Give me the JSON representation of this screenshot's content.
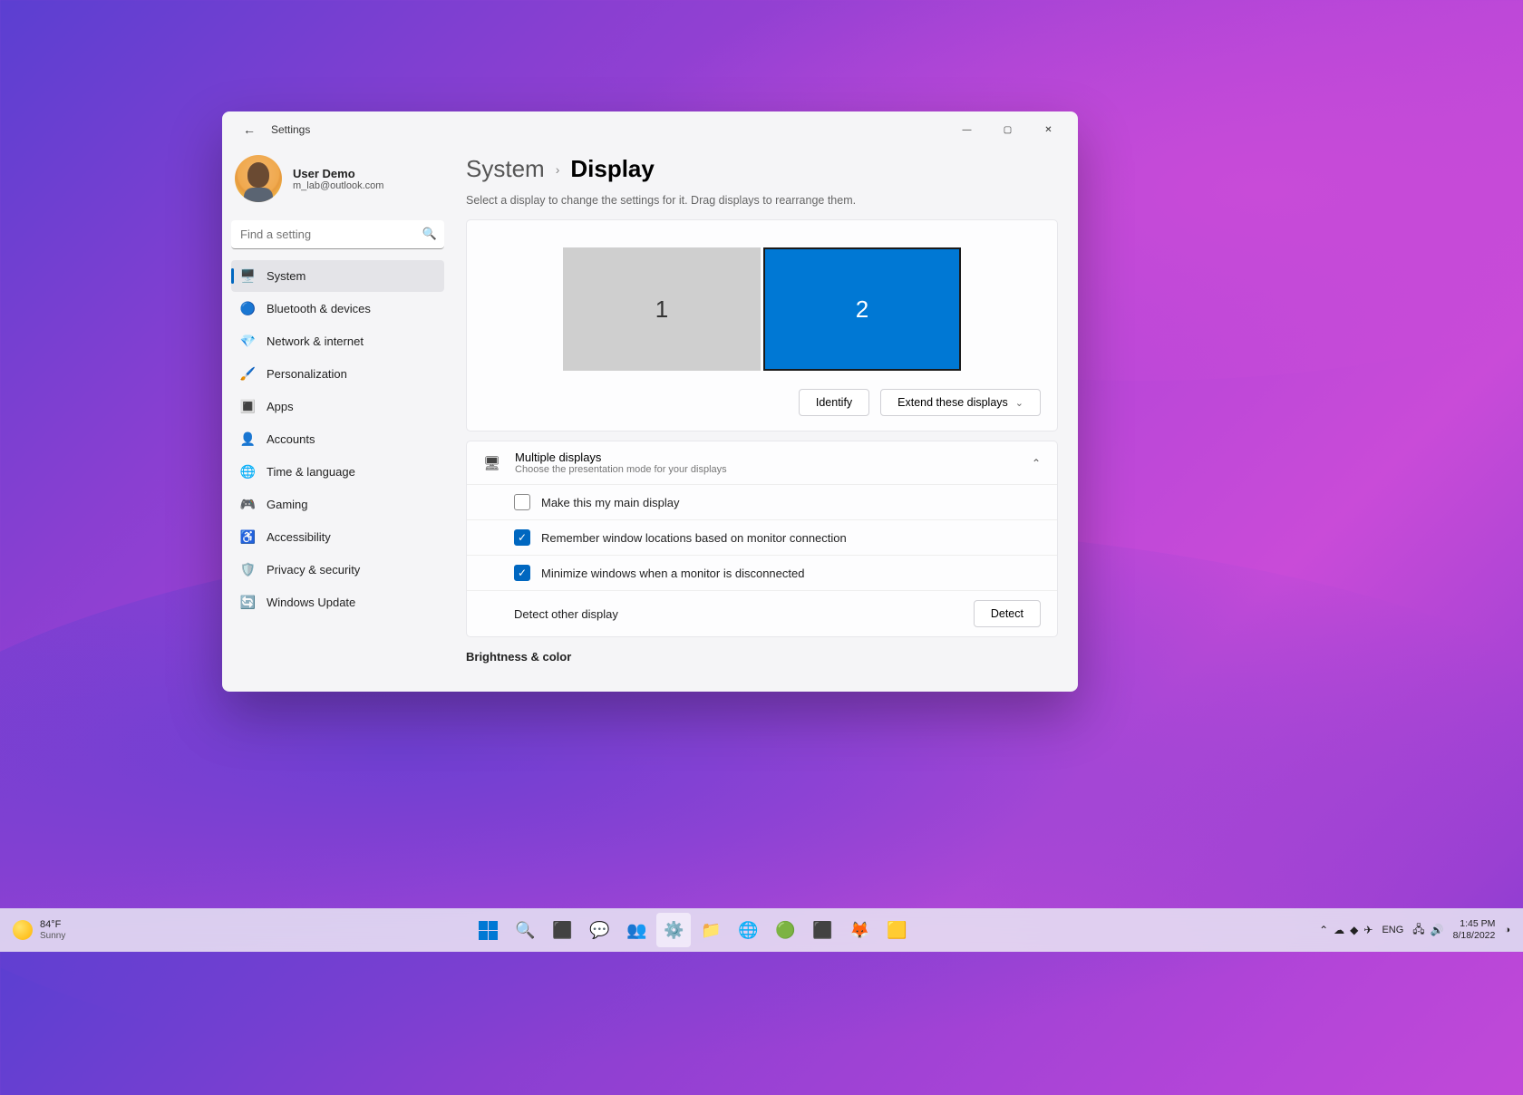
{
  "window": {
    "title": "Settings",
    "user": {
      "name": "User Demo",
      "email": "m_lab@outlook.com"
    },
    "search": {
      "placeholder": "Find a setting"
    },
    "nav": [
      {
        "label": "System",
        "icon": "🖥️",
        "active": true
      },
      {
        "label": "Bluetooth & devices",
        "icon": "🔵"
      },
      {
        "label": "Network & internet",
        "icon": "💎"
      },
      {
        "label": "Personalization",
        "icon": "🖌️"
      },
      {
        "label": "Apps",
        "icon": "🔳"
      },
      {
        "label": "Accounts",
        "icon": "👤"
      },
      {
        "label": "Time & language",
        "icon": "🌐"
      },
      {
        "label": "Gaming",
        "icon": "🎮"
      },
      {
        "label": "Accessibility",
        "icon": "♿"
      },
      {
        "label": "Privacy & security",
        "icon": "🛡️"
      },
      {
        "label": "Windows Update",
        "icon": "🔄"
      }
    ],
    "breadcrumb": {
      "parent": "System",
      "current": "Display"
    },
    "subtitle": "Select a display to change the settings for it. Drag displays to rearrange them.",
    "monitors": {
      "m1": "1",
      "m2": "2"
    },
    "identify": "Identify",
    "extend": "Extend these displays",
    "multi": {
      "title": "Multiple displays",
      "sub": "Choose the presentation mode for your displays",
      "opt1": "Make this my main display",
      "opt2": "Remember window locations based on monitor connection",
      "opt3": "Minimize windows when a monitor is disconnected",
      "detect_label": "Detect other display",
      "detect_btn": "Detect"
    },
    "section2": "Brightness & color"
  },
  "taskbar": {
    "temp": "84°F",
    "weather": "Sunny",
    "lang": "ENG",
    "time": "1:45 PM",
    "date": "8/18/2022"
  }
}
